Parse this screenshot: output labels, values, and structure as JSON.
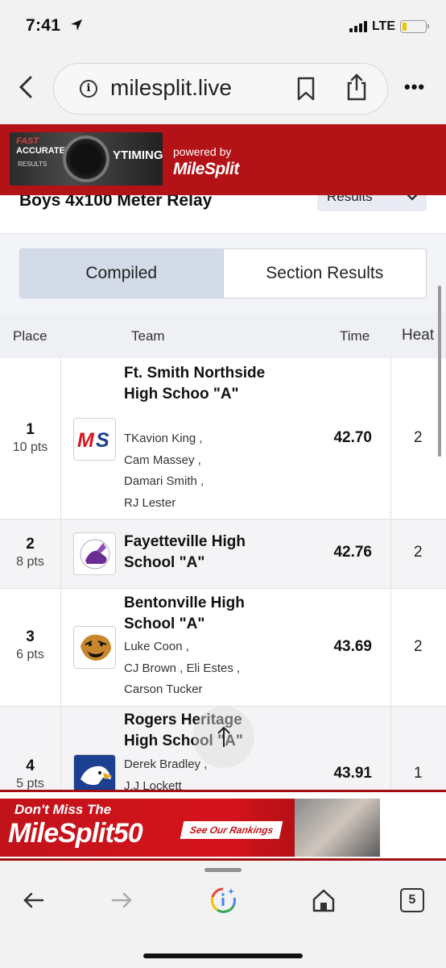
{
  "status": {
    "time": "7:41",
    "network": "LTE"
  },
  "browser": {
    "url": "milesplit.live",
    "tab_count": "5"
  },
  "top_ad": {
    "line1": "FAST",
    "line2": "ACCURATE",
    "line3": "RESULTS",
    "brand": "YTIMING",
    "powered_by": "powered by",
    "logo": "MileSplit"
  },
  "event": {
    "title": "Boys 4x100 Meter Relay",
    "view_select": "Results"
  },
  "tabs": [
    {
      "label": "Compiled",
      "active": true
    },
    {
      "label": "Section Results",
      "active": false
    }
  ],
  "table": {
    "headers": {
      "place": "Place",
      "team": "Team",
      "time": "Time",
      "heat": "Heat"
    },
    "rows": [
      {
        "place": "1",
        "points": "10 pts",
        "team": "Ft. Smith Northside High Schoo \"A\"",
        "athletes": [
          "TKavion King ,",
          "Cam Massey ,",
          "Damari Smith ,",
          "RJ Lester"
        ],
        "time": "42.70",
        "heat": "2",
        "logo": "MS"
      },
      {
        "place": "2",
        "points": "8 pts",
        "team": "Fayetteville High School \"A\"",
        "athletes": [],
        "time": "42.76",
        "heat": "2",
        "logo": "Fayetteville Track"
      },
      {
        "place": "3",
        "points": "6 pts",
        "team": "Bentonville High School \"A\"",
        "athletes": [
          "Luke Coon ,",
          "CJ Brown ,  Eli Estes ,",
          "Carson Tucker"
        ],
        "time": "43.69",
        "heat": "2",
        "logo": "Tiger"
      },
      {
        "place": "4",
        "points": "5 pts",
        "team": "Rogers Heritage High School \"A\"",
        "athletes": [
          "Derek Bradley ,",
          "J.J Lockett"
        ],
        "time": "43.91",
        "heat": "1",
        "logo": "Eagle"
      }
    ]
  },
  "bottom_ad": {
    "headline": "Don't Miss The",
    "brand": "MileSplit50",
    "cta": "See Our Rankings"
  },
  "colors": {
    "brand_red": "#b31217",
    "tab_active": "#d3dbe9"
  }
}
